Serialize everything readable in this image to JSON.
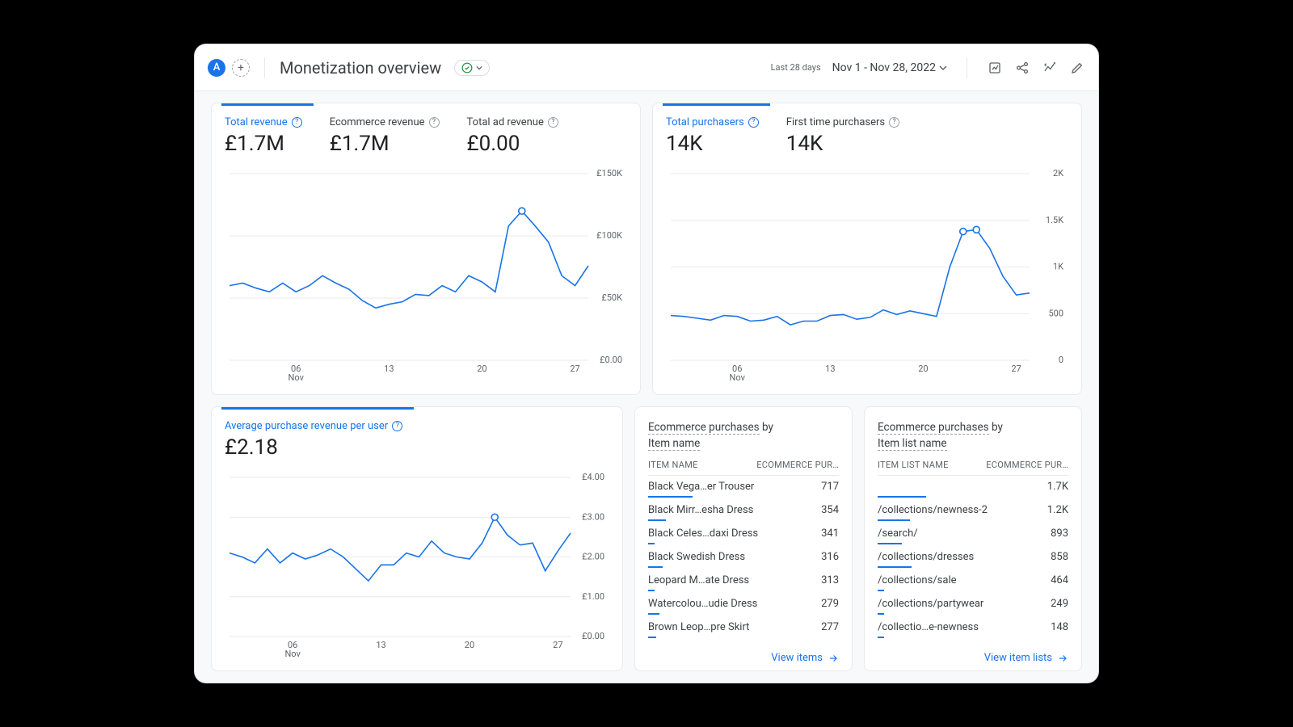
{
  "header": {
    "avatar_letter": "A",
    "title": "Monetization overview",
    "date_hint": "Last 28 days",
    "date_range": "Nov 1 - Nov 28, 2022"
  },
  "card_revenue": {
    "tabs": [
      {
        "label": "Total revenue",
        "value": "£1.7M",
        "active": true
      },
      {
        "label": "Ecommerce revenue",
        "value": "£1.7M",
        "active": false
      },
      {
        "label": "Total ad revenue",
        "value": "£0.00",
        "active": false
      }
    ]
  },
  "card_purchasers": {
    "tabs": [
      {
        "label": "Total purchasers",
        "value": "14K",
        "active": true
      },
      {
        "label": "First time purchasers",
        "value": "14K",
        "active": false
      }
    ]
  },
  "card_avg": {
    "tabs": [
      {
        "label": "Average purchase revenue per user",
        "value": "£2.18",
        "active": true
      }
    ]
  },
  "table_items": {
    "title_a": "Ecommerce purchases",
    "title_mid": " by ",
    "title_b": "Item name",
    "head_a": "ITEM NAME",
    "head_b": "ECOMMERCE PUR…",
    "rows": [
      {
        "name": "Black Vega…er Trouser",
        "val": "717",
        "spark": 55
      },
      {
        "name": "Black Mirr…esha Dress",
        "val": "354",
        "spark": 22
      },
      {
        "name": "Black Celes…daxi Dress",
        "val": "341",
        "spark": 8
      },
      {
        "name": "Black Swedish Dress",
        "val": "316",
        "spark": 18
      },
      {
        "name": "Leopard M…ate Dress",
        "val": "313",
        "spark": 8
      },
      {
        "name": "Watercolou…udie Dress",
        "val": "279",
        "spark": 14
      },
      {
        "name": "Brown Leop…pre Skirt",
        "val": "277",
        "spark": 10
      }
    ],
    "footer": "View items"
  },
  "table_lists": {
    "title_a": "Ecommerce purchases",
    "title_mid": " by ",
    "title_b": "Item list name",
    "head_a": "ITEM LIST NAME",
    "head_b": "ECOMMERCE PUR…",
    "rows": [
      {
        "name": "",
        "val": "1.7K",
        "spark": 60
      },
      {
        "name": "/collections/newness-2",
        "val": "1.2K",
        "spark": 40
      },
      {
        "name": "/search/",
        "val": "893",
        "spark": 30
      },
      {
        "name": "/collections/dresses",
        "val": "858",
        "spark": 42
      },
      {
        "name": "/collections/sale",
        "val": "464",
        "spark": 8
      },
      {
        "name": "/collections/partywear",
        "val": "249",
        "spark": 8
      },
      {
        "name": "/collectio…e-newness",
        "val": "148",
        "spark": 8
      }
    ],
    "footer": "View item lists"
  },
  "chart_data": [
    {
      "id": "revenue",
      "type": "line",
      "title": "Total revenue",
      "xlabel": "",
      "ylabel": "",
      "x_ticks": [
        "06\nNov",
        "13",
        "20",
        "27"
      ],
      "y_ticks": [
        "£0.00",
        "£50K",
        "£100K",
        "£150K"
      ],
      "ylim": [
        0,
        150000
      ],
      "highlight_index": 22,
      "x": [
        1,
        2,
        3,
        4,
        5,
        6,
        7,
        8,
        9,
        10,
        11,
        12,
        13,
        14,
        15,
        16,
        17,
        18,
        19,
        20,
        21,
        22,
        23,
        24,
        25,
        26,
        27,
        28
      ],
      "values": [
        60000,
        62000,
        58000,
        55000,
        62000,
        55000,
        60000,
        68000,
        62000,
        57000,
        48000,
        42000,
        45000,
        47000,
        53000,
        52000,
        60000,
        55000,
        68000,
        63000,
        55000,
        108000,
        120000,
        108000,
        95000,
        68000,
        60000,
        76000
      ]
    },
    {
      "id": "purchasers",
      "type": "line",
      "title": "Total purchasers",
      "x_ticks": [
        "06\nNov",
        "13",
        "20",
        "27"
      ],
      "y_ticks": [
        "0",
        "500",
        "1K",
        "1.5K",
        "2K"
      ],
      "ylim": [
        0,
        2000
      ],
      "highlight_index": 22,
      "highlight_index2": 23,
      "x": [
        1,
        2,
        3,
        4,
        5,
        6,
        7,
        8,
        9,
        10,
        11,
        12,
        13,
        14,
        15,
        16,
        17,
        18,
        19,
        20,
        21,
        22,
        23,
        24,
        25,
        26,
        27,
        28
      ],
      "values": [
        480,
        470,
        450,
        430,
        480,
        470,
        420,
        430,
        470,
        380,
        420,
        420,
        480,
        490,
        440,
        460,
        540,
        490,
        530,
        500,
        470,
        1000,
        1380,
        1400,
        1200,
        900,
        700,
        720
      ]
    },
    {
      "id": "avg",
      "type": "line",
      "title": "Average purchase revenue per user",
      "x_ticks": [
        "06\nNov",
        "13",
        "20",
        "27"
      ],
      "y_ticks": [
        "£0.00",
        "£1.00",
        "£2.00",
        "£3.00",
        "£4.00"
      ],
      "ylim": [
        0,
        4
      ],
      "highlight_index": 21,
      "x": [
        1,
        2,
        3,
        4,
        5,
        6,
        7,
        8,
        9,
        10,
        11,
        12,
        13,
        14,
        15,
        16,
        17,
        18,
        19,
        20,
        21,
        22,
        23,
        24,
        25,
        26,
        27,
        28
      ],
      "values": [
        2.1,
        2.0,
        1.85,
        2.2,
        1.85,
        2.1,
        1.95,
        2.05,
        2.2,
        2.0,
        1.7,
        1.4,
        1.8,
        1.8,
        2.1,
        2.0,
        2.4,
        2.1,
        2.0,
        1.95,
        2.35,
        3.0,
        2.55,
        2.3,
        2.35,
        1.65,
        2.15,
        2.6
      ]
    }
  ]
}
